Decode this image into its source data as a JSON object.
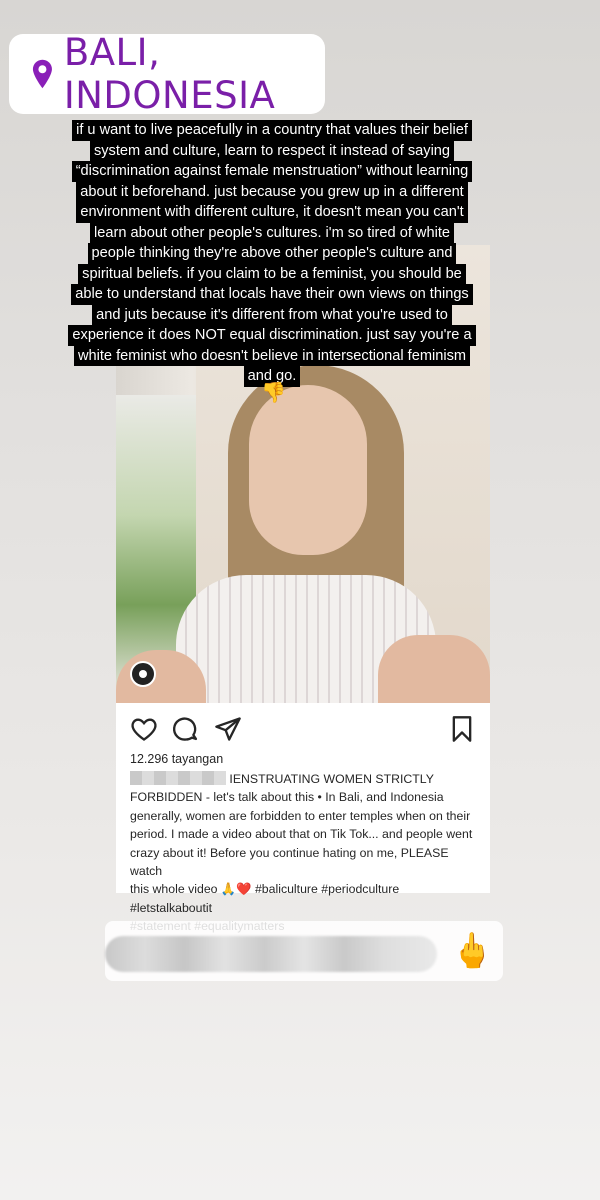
{
  "location_sticker": {
    "icon": "location-pin-icon",
    "text": "BALI, INDONESIA",
    "color": "#7a1fa8"
  },
  "story_caption": {
    "lines": [
      "if u want to live peacefully in a country that values their belief",
      "system and culture, learn to respect it instead of saying",
      "“discrimination against female menstruation” without learning",
      "about it beforehand. just because you grew up in a different",
      "environment with different culture, it doesn't mean you can't",
      "learn about other people's cultures. i'm so tired of white",
      "people thinking they're above other people's culture and",
      "spiritual beliefs. if you claim to be a feminist, you should be",
      "able to understand that locals have their own views on things",
      "and juts because it's different from what you're used to",
      "experience it does NOT equal discrimination. just say you're a",
      "white feminist who doesn't believe in intersectional feminism",
      "and go."
    ],
    "emoji": "👎"
  },
  "post": {
    "video_badge_icon": "igtv-icon",
    "actions": {
      "like": "heart-icon",
      "comment": "comment-icon",
      "share": "send-icon",
      "save": "bookmark-icon"
    },
    "views": "12.296 tayangan",
    "description": {
      "headline": "IENSTRUATING WOMEN STRICTLY",
      "line2": "FORBIDDEN - let's talk about this  • In Bali, and Indonesia",
      "line3": "generally, women are forbidden to enter temples when on their",
      "line4": "period. I made a video about that on Tik Tok... and people went",
      "line5": "crazy about it! Before you continue hating on me, PLEASE watch",
      "line6_text": "this whole video ",
      "line6_emoji": "🙏❤️",
      "line6_tags": " #baliculture #periodculture #letstalkaboutit",
      "line7": "#statement #equalitymatters"
    }
  },
  "reply_bar": {
    "emoji": "🖕"
  }
}
